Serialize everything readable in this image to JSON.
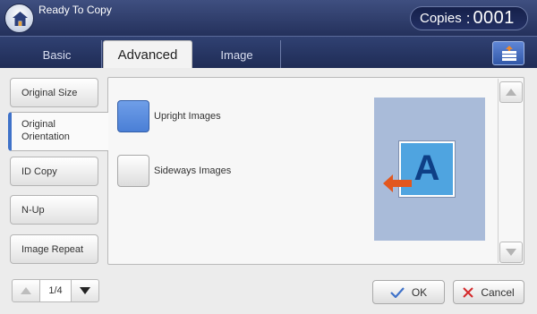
{
  "header": {
    "status_title": "Ready To Copy",
    "copies_label": "Copies",
    "copies_separator": ":",
    "copies_value": "0001"
  },
  "tabs": [
    {
      "label": "Basic",
      "active": false
    },
    {
      "label": "Advanced",
      "active": true
    },
    {
      "label": "Image",
      "active": false
    }
  ],
  "sidebar": {
    "items": [
      {
        "label": "Original Size",
        "active": false
      },
      {
        "label": "Original Orientation",
        "active": true
      },
      {
        "label": "ID Copy",
        "active": false
      },
      {
        "label": "N-Up",
        "active": false
      },
      {
        "label": "Image Repeat",
        "active": false
      }
    ]
  },
  "options": [
    {
      "label": "Upright Images",
      "selected": true
    },
    {
      "label": "Sideways Images",
      "selected": false
    }
  ],
  "preview": {
    "letter": "A"
  },
  "pager": {
    "page": "1/4"
  },
  "actions": {
    "ok_label": "OK",
    "cancel_label": "Cancel"
  },
  "colors": {
    "accent": "#3f72c9",
    "header": "#2a3766",
    "preview_bg": "#a9bbd9",
    "page_fill": "#4fa4e0",
    "arrow": "#e2571e",
    "cancel_x": "#d4282a"
  }
}
